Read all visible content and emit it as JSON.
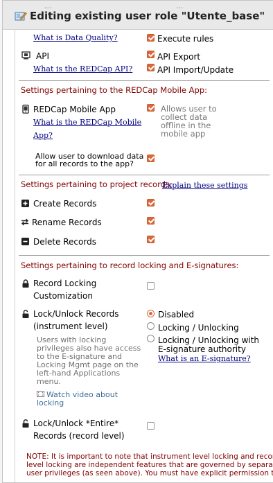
{
  "dialog": {
    "title": "Editing existing user role \"Utente_base\"",
    "background_text_left": "...",
    "background_text_right": "..."
  },
  "data_quality": {
    "help_link": "What is Data Quality?",
    "execute_rules_label": "Execute rules",
    "execute_rules_checked": true
  },
  "api": {
    "label": "API",
    "help_link": "What is the REDCap API?",
    "export_label": "API Export",
    "export_checked": true,
    "import_label": "API Import/Update",
    "import_checked": true
  },
  "mobile_section": {
    "heading": "Settings pertaining to the REDCap Mobile App:",
    "app_label": "REDCap Mobile App",
    "help_link_line1": "What is the REDCap Mobile",
    "help_link_line2": "App?",
    "allow_offline_line1": "Allows user to",
    "allow_offline_line2": "collect data",
    "allow_offline_line3": "offline in the",
    "allow_offline_line4": "mobile app",
    "allow_offline_checked": true,
    "download_line1": "Allow user to download data",
    "download_line2": "for all records to the app?",
    "download_checked": true
  },
  "records_section": {
    "heading": "Settings pertaining to project records:",
    "explain_link": "Explain these settings",
    "create_label": "Create Records",
    "create_checked": true,
    "rename_label": "Rename Records",
    "rename_checked": true,
    "delete_label": "Delete Records",
    "delete_checked": true
  },
  "locking_section": {
    "heading": "Settings pertaining to record locking and E-signatures:",
    "customization_line1": "Record Locking",
    "customization_line2": "Customization",
    "customization_checked": false,
    "lock_unlock_line1": "Lock/Unlock Records",
    "lock_unlock_line2": "(instrument level)",
    "options": [
      {
        "label": "Disabled",
        "selected": true
      },
      {
        "label": "Locking / Unlocking",
        "selected": false
      },
      {
        "label_line1": "Locking / Unlocking with",
        "label_line2": "E-signature authority",
        "selected": false
      }
    ],
    "esig_link": "What is an E-signature?",
    "info_lines": [
      "Users with locking",
      "privileges also have access",
      "to the E-signature and",
      "Locking Mgmt page on the",
      "left-hand Applications",
      "menu."
    ],
    "video_line1": "Watch video about",
    "video_line2": "locking",
    "entire_line1": "Lock/Unlock *Entire*",
    "entire_line2": "Records (record level)",
    "entire_checked": false,
    "note_lines": [
      "NOTE: It is important to note that instrument level locking and record",
      "level locking are independent features that are governed by separate",
      "user privileges (as seen above). You must have explicit permission to"
    ]
  },
  "colors": {
    "section_heading": "#800000",
    "link": "#000080",
    "checkbox_accent": "#d9693a"
  }
}
